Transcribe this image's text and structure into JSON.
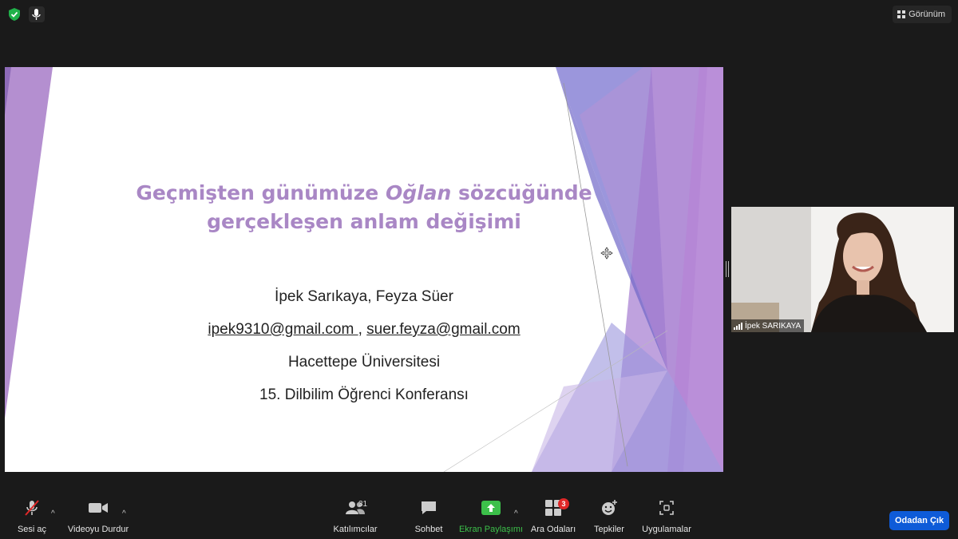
{
  "topbar": {
    "view_label": "Görünüm"
  },
  "slide": {
    "title_pre": "Geçmişten günümüze ",
    "title_italic": "Oğlan",
    "title_post": " sözcüğünde",
    "title_line2": "gerçekleşen anlam değişimi",
    "authors": "İpek Sarıkaya, Feyza Süer",
    "email1": "ipek9310@gmail.com ",
    "email_sep": ", ",
    "email2": "suer.feyza@gmail.com",
    "university": "Hacettepe Üniversitesi",
    "conference": "15. Dilbilim Öğrenci Konferansı"
  },
  "participant": {
    "name": "İpek SARIKAYA"
  },
  "toolbar": {
    "mute_label": "Sesi aç",
    "video_label": "Videoyu Durdur",
    "participants_label": "Katılımcılar",
    "participants_count": "31",
    "chat_label": "Sohbet",
    "share_label": "Ekran Paylaşımı",
    "breakout_label": "Ara Odaları",
    "breakout_badge": "3",
    "reactions_label": "Tepkiler",
    "apps_label": "Uygulamalar",
    "leave_label": "Odadan Çık"
  },
  "colors": {
    "accent_purple": "#a987c5",
    "share_green": "#3cc04a",
    "leave_blue": "#0e5bd8",
    "badge_red": "#e02828"
  }
}
